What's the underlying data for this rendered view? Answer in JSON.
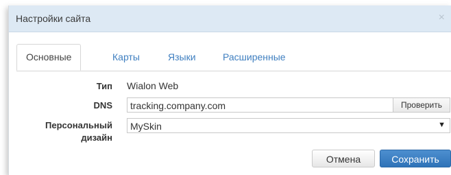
{
  "dialog": {
    "title": "Настройки сайта",
    "close_glyph": "×"
  },
  "tabs": [
    {
      "label": "Основные",
      "active": true
    },
    {
      "label": "Карты",
      "active": false
    },
    {
      "label": "Языки",
      "active": false
    },
    {
      "label": "Расширенные",
      "active": false
    }
  ],
  "form": {
    "type_label": "Тип",
    "type_value": "Wialon Web",
    "dns_label": "DNS",
    "dns_value": "tracking.company.com",
    "check_button": "Проверить",
    "design_label_line1": "Персональный",
    "design_label_line2": "дизайн",
    "design_value": "MySkin",
    "design_caret": "▼"
  },
  "buttons": {
    "cancel": "Отмена",
    "save": "Сохранить"
  },
  "colors": {
    "titlebar": "#dde9f4",
    "link": "#3f7fc0",
    "primary": "#2f73b8"
  }
}
